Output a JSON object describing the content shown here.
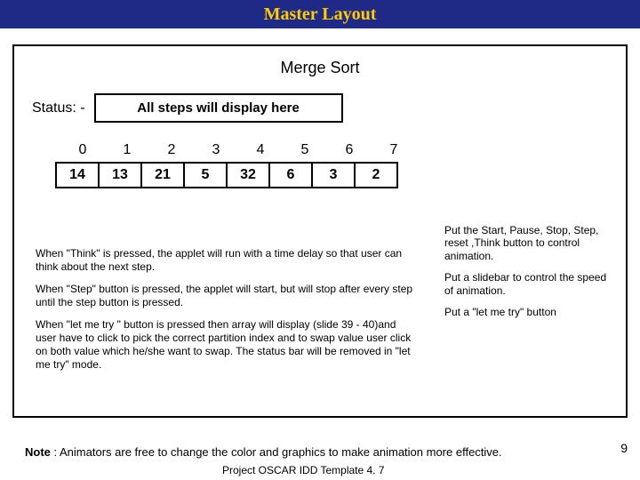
{
  "titlebar": "Master Layout",
  "algo_title": "Merge Sort",
  "status_label": "Status: -",
  "status_text": "All steps will display here",
  "indices": [
    "0",
    "1",
    "2",
    "3",
    "4",
    "5",
    "6",
    "7"
  ],
  "values": [
    "14",
    "13",
    "21",
    "5",
    "32",
    "6",
    "3",
    "2"
  ],
  "side": {
    "p1": "Put the Start, Pause, Stop, Step, reset ,Think button to control  animation.",
    "p2": "Put a slidebar to control the speed of animation.",
    "p3": "Put a \"let me try\" button"
  },
  "desc": {
    "p1": "When \"Think\" is pressed, the applet will run with a time delay so that user can think about the next step.",
    "p2": "When \"Step\" button is pressed, the applet will start, but will stop after every step until the step button is pressed.",
    "p3": "When \"let me try \" button is pressed then array will display (slide 39 - 40)and user have to click to pick the correct partition index and to swap value user click on both value which he/she want to swap. The status bar will be removed in \"let me try\" mode."
  },
  "note_label": "Note",
  "note_text": " : Animators are free to change the  color and graphics to make animation more effective.",
  "footer": "Project OSCAR IDD Template 4. 7",
  "page_num": "9"
}
